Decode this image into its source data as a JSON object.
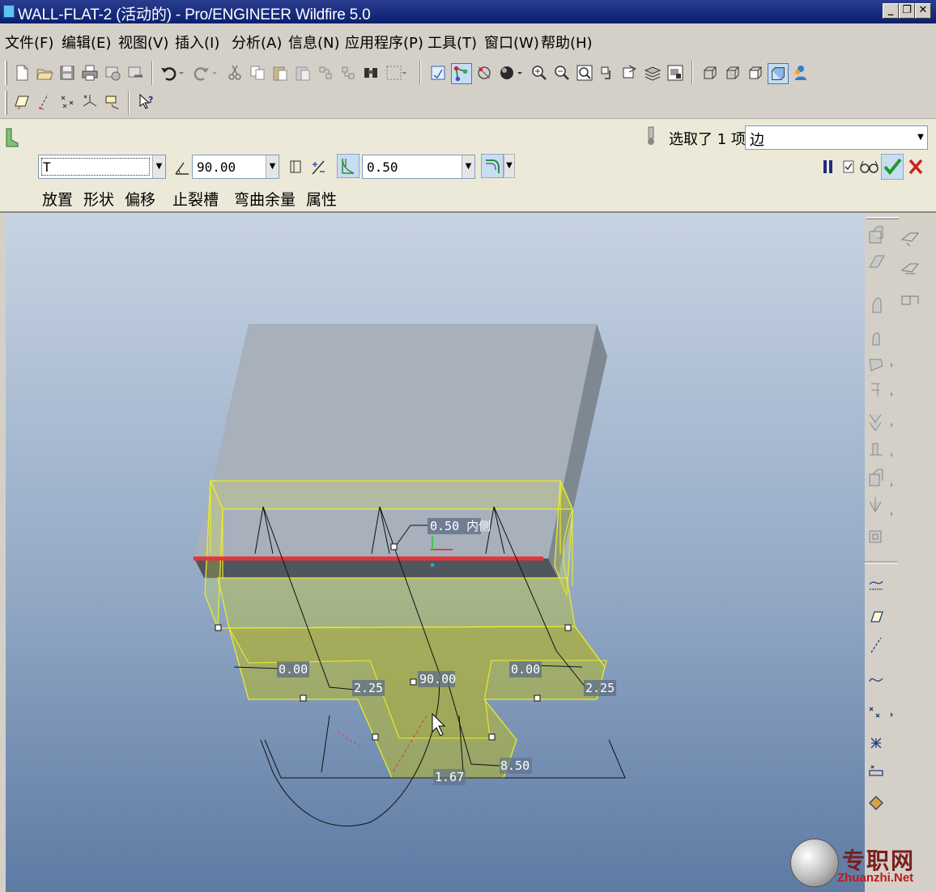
{
  "window": {
    "title": "WALL-FLAT-2 (活动的) - Pro/ENGINEER Wildfire 5.0",
    "controls": [
      "_",
      "❐",
      "✕"
    ]
  },
  "menubar": {
    "items": [
      "文件(F)",
      "编辑(E)",
      "视图(V)",
      "插入(I)",
      "分析(A)",
      "信息(N)",
      "应用程序(P)",
      "工具(T)",
      "窗口(W)",
      "帮助(H)"
    ]
  },
  "dashboard": {
    "selection_label": "选取了 1 项",
    "selection_value": "边",
    "shape_value": "T",
    "angle_value": "90.00",
    "thickness_value": "0.50",
    "tabs": [
      "放置",
      "形状",
      "偏移",
      "止裂槽",
      "弯曲余量",
      "属性"
    ]
  },
  "model": {
    "dims": {
      "thickness_callout": "0.50 内侧",
      "offset_left": "0.00",
      "offset_right": "0.00",
      "height_left": "2.25",
      "height_right": "2.25",
      "angle": "90.00",
      "width": "1.67",
      "tab_height": "8.50"
    },
    "colors": {
      "wall_preview": "#e9ec2a",
      "selected_edge": "#e8323a",
      "sheet_face": "#9fa9b6",
      "sheet_side": "#7d8790"
    }
  },
  "watermark": {
    "chinese": "专职网",
    "url": "Zhuanzhi.Net"
  }
}
